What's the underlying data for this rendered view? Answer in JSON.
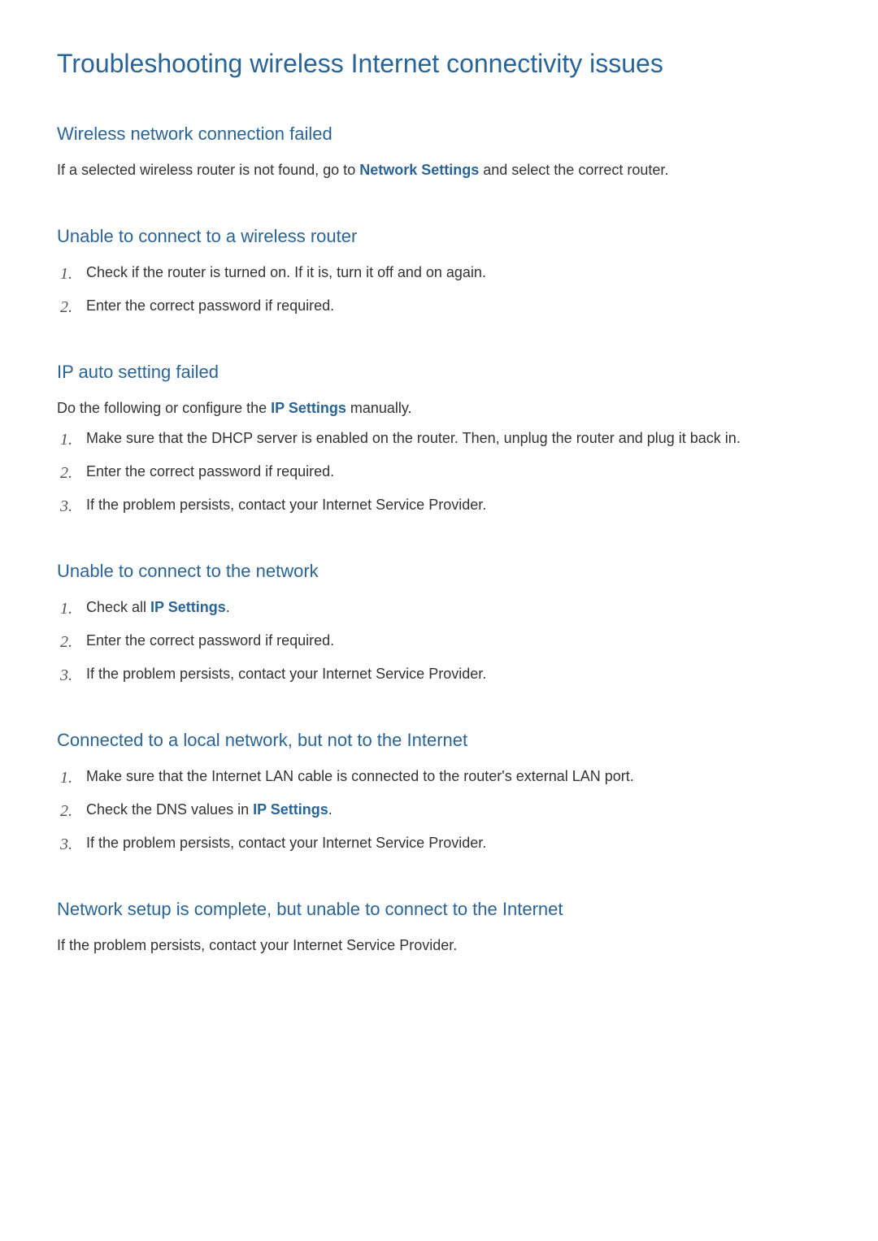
{
  "title": "Troubleshooting wireless Internet connectivity issues",
  "sections": [
    {
      "heading": "Wireless network connection failed",
      "intro_segments": [
        {
          "text": "If a selected wireless router is not found, go to ",
          "link": false
        },
        {
          "text": "Network Settings",
          "link": true
        },
        {
          "text": " and select the correct router.",
          "link": false
        }
      ],
      "steps": []
    },
    {
      "heading": "Unable to connect to a wireless router",
      "intro_segments": [],
      "steps": [
        [
          {
            "text": "Check if the router is turned on. If it is, turn it off and on again.",
            "link": false
          }
        ],
        [
          {
            "text": "Enter the correct password if required.",
            "link": false
          }
        ]
      ]
    },
    {
      "heading": "IP auto setting failed",
      "intro_segments": [
        {
          "text": "Do the following or configure the ",
          "link": false
        },
        {
          "text": "IP Settings",
          "link": true
        },
        {
          "text": " manually.",
          "link": false
        }
      ],
      "steps": [
        [
          {
            "text": "Make sure that the DHCP server is enabled on the router. Then, unplug the router and plug it back in.",
            "link": false
          }
        ],
        [
          {
            "text": "Enter the correct password if required.",
            "link": false
          }
        ],
        [
          {
            "text": "If the problem persists, contact your Internet Service Provider.",
            "link": false
          }
        ]
      ]
    },
    {
      "heading": "Unable to connect to the network",
      "intro_segments": [],
      "steps": [
        [
          {
            "text": "Check all ",
            "link": false
          },
          {
            "text": "IP Settings",
            "link": true
          },
          {
            "text": ".",
            "link": false
          }
        ],
        [
          {
            "text": "Enter the correct password if required.",
            "link": false
          }
        ],
        [
          {
            "text": "If the problem persists, contact your Internet Service Provider.",
            "link": false
          }
        ]
      ]
    },
    {
      "heading": "Connected to a local network, but not to the Internet",
      "intro_segments": [],
      "steps": [
        [
          {
            "text": "Make sure that the Internet LAN cable is connected to the router's external LAN port.",
            "link": false
          }
        ],
        [
          {
            "text": "Check the DNS values in ",
            "link": false
          },
          {
            "text": "IP Settings",
            "link": true
          },
          {
            "text": ".",
            "link": false
          }
        ],
        [
          {
            "text": "If the problem persists, contact your Internet Service Provider.",
            "link": false
          }
        ]
      ]
    },
    {
      "heading": "Network setup is complete, but unable to connect to the Internet",
      "intro_segments": [
        {
          "text": "If the problem persists, contact your Internet Service Provider.",
          "link": false
        }
      ],
      "steps": []
    }
  ]
}
